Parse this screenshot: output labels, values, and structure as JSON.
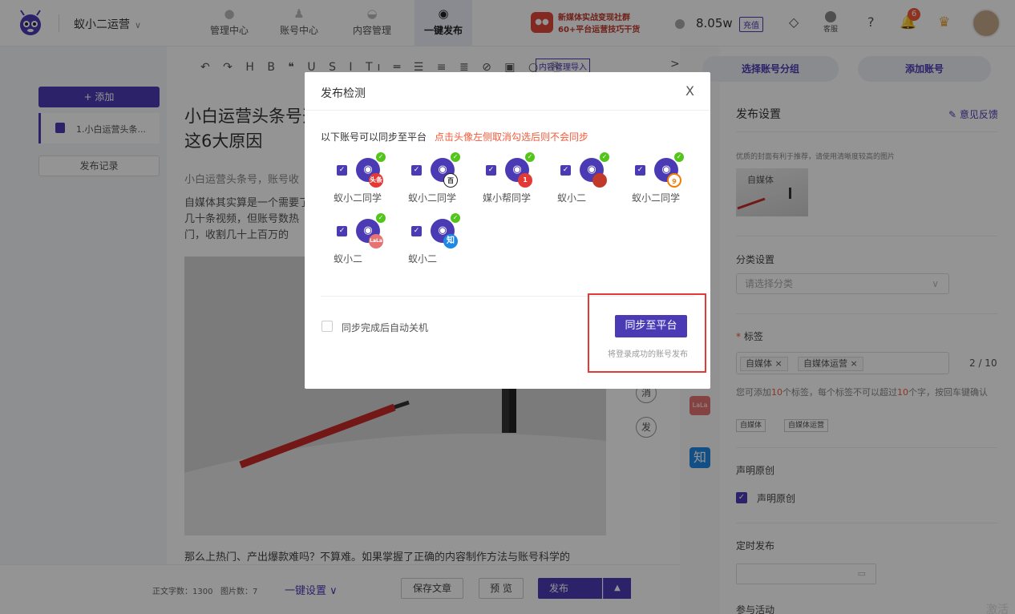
{
  "header": {
    "team_name": "蚁小二运营",
    "nav": [
      {
        "label": "管理中心",
        "icon": "management-icon"
      },
      {
        "label": "账号中心",
        "icon": "account-icon"
      },
      {
        "label": "内容管理",
        "icon": "content-icon"
      },
      {
        "label": "一键发布",
        "icon": "publish-icon",
        "active": true
      }
    ],
    "banner": {
      "line1": "新媒体实战变现社群",
      "line2": "60+平台运营技巧干货"
    },
    "balance": "8.05w",
    "recharge_label": "充值",
    "service_label": "客服",
    "notification_count": "6"
  },
  "left_panel": {
    "add_label": "+ 添加",
    "doc_label": "1.小白运营头条...",
    "history_label": "发布记录"
  },
  "editor": {
    "toolbar_glyphs": "↶ ↷ H B ❝ U S I Tı ═ ☰ ≡ ≣ ⊘ ▣ ○ ⎘",
    "import_label": "内容管理导入",
    "title": "小白运营头条号开这6大原因",
    "summary": "小白运营头条号，账号收",
    "body": "自媒体其实算是一个需要了几十条视频，但账号数热门，收割几十上百万的",
    "bottom_text": "那么上热门、产出爆款难吗？不算难。如果掌握了正确的内容制作方法与账号科学的",
    "side_icons": [
      "消",
      "发"
    ]
  },
  "bottom_bar": {
    "word_count": "正文字数：1300",
    "image_count": "图片数：7",
    "onekey_label": "一键设置 ∨",
    "save_label": "保存文章",
    "preview_label": "预 览",
    "publish_label": "发布"
  },
  "right_panel": {
    "select_group_label": "选择账号分组",
    "add_account_label": "添加账号",
    "title": "发布设置",
    "feedback_label": "意见反馈",
    "cover_hint": "优质的封面有利于推荐，请使用清晰度较高的图片",
    "cover_text": "自媒体",
    "category_label": "分类设置",
    "category_placeholder": "请选择分类",
    "tag_label": "标签",
    "tags": [
      "自媒体 ×",
      "自媒体运营 ×"
    ],
    "tag_count": "2 / 10",
    "tag_hint_parts": [
      "您可添加",
      "10",
      "个标签，每个标签不可以超过",
      "10",
      "个字，按回车键确认"
    ],
    "suggested_tags": [
      "自媒体",
      "自媒体运营"
    ],
    "original_section_label": "声明原创",
    "original_checkbox_label": "声明原创",
    "schedule_label": "定时发布",
    "activity_label": "参与活动",
    "watermark": "激活"
  },
  "modal": {
    "title": "发布检测",
    "close_glyph": "X",
    "info": "以下账号可以同步至平台",
    "warning": "点击头像左侧取消勾选后则不会同步",
    "accounts": [
      {
        "name": "蚁小二同学",
        "platform": "头条",
        "platform_color": "#e53935"
      },
      {
        "name": "蚁小二同学",
        "platform": "百",
        "platform_color": "#222222"
      },
      {
        "name": "媒小帮同学",
        "platform": "1",
        "platform_color": "#e53935"
      },
      {
        "name": "蚁小二",
        "platform": "",
        "platform_color": "#c0392b"
      },
      {
        "name": "蚁小二同学",
        "platform": "9",
        "platform_color": "#f57c00"
      },
      {
        "name": "蚁小二",
        "platform": "LaLa",
        "platform_color": "#e57373"
      },
      {
        "name": "蚁小二",
        "platform": "知",
        "platform_color": "#1e88e5"
      }
    ],
    "auto_shutdown_label": "同步完成后自动关机",
    "sync_label": "同步至平台",
    "sync_hint": "将登录成功的账号发布"
  },
  "colors": {
    "accent": "#4a3bb5",
    "warning": "#f25a3a",
    "highlight_box": "#e53935"
  }
}
